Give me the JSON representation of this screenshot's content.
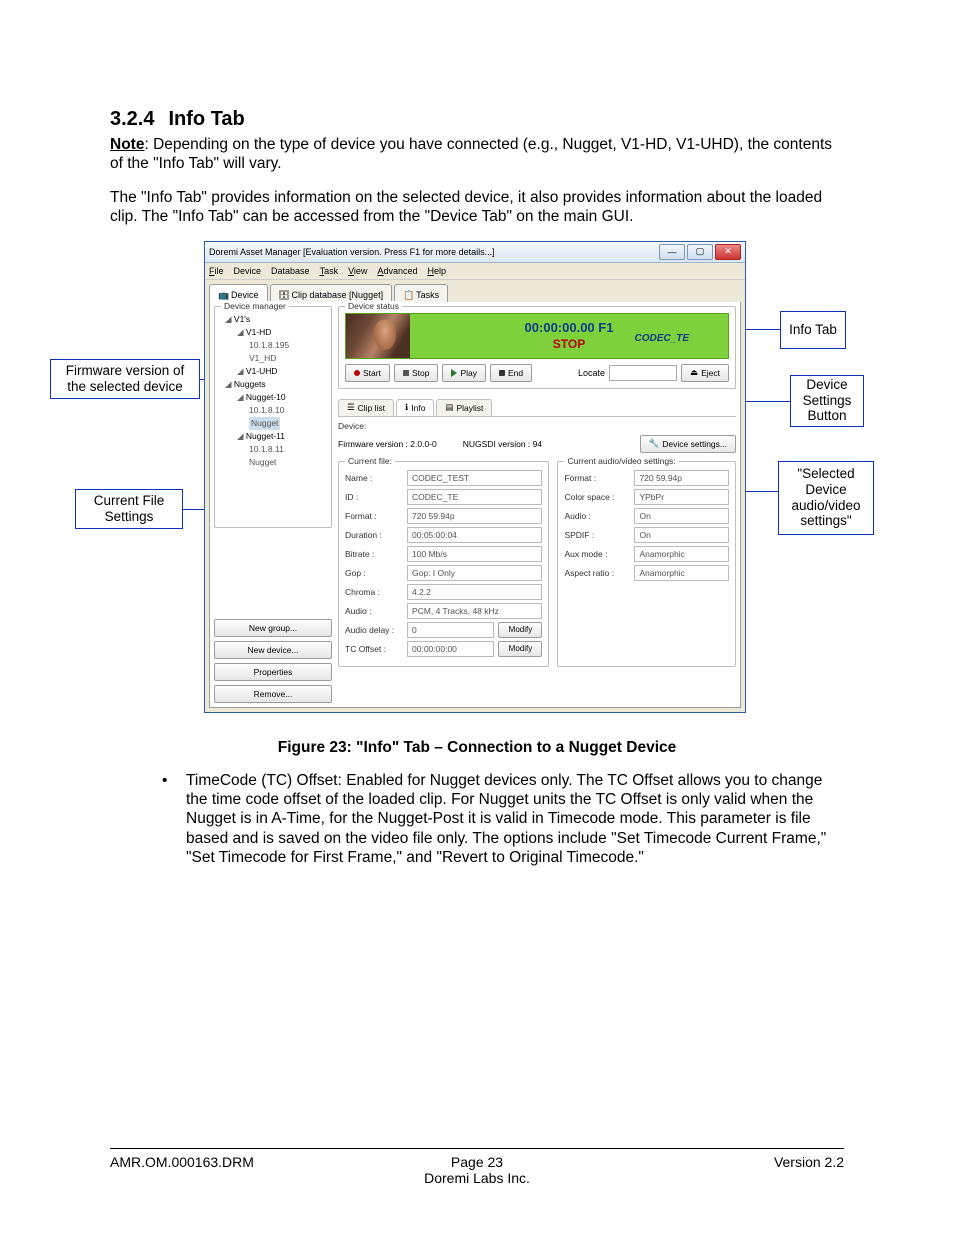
{
  "heading": {
    "num": "3.2.4",
    "title": "Info Tab"
  },
  "note_label": "Note",
  "note_text": ": Depending on the type of device you have connected (e.g., Nugget, V1-HD, V1-UHD), the contents of the \"Info Tab\" will vary.",
  "para2": "The \"Info Tab\" provides information on the selected device, it also provides information about the loaded clip. The \"Info Tab\" can be accessed from the \"Device Tab\" on the main GUI.",
  "figure_caption": "Figure 23: \"Info\" Tab – Connection to a Nugget Device",
  "bullet": {
    "marker": "•",
    "text": "TimeCode (TC) Offset: Enabled for Nugget devices only. The TC Offset allows you to change the time code offset of the loaded clip. For Nugget units the TC Offset is only valid when the Nugget is in A-Time, for the Nugget-Post it is valid in Timecode mode. This parameter is file based and is saved on the video file only.  The options include \"Set Timecode Current Frame,\" \"Set Timecode for First Frame,\" and \"Revert to Original Timecode.\""
  },
  "callouts": {
    "firmware": "Firmware version of the selected device",
    "current_file": "Current File Settings",
    "info_tab": "Info Tab",
    "device_settings": "Device Settings Button",
    "selected_av": "\"Selected Device audio/video settings\""
  },
  "window": {
    "title": "Doremi Asset Manager [Evaluation version. Press F1 for more details...]",
    "menu": [
      "File",
      "Device",
      "Database",
      "Task",
      "View",
      "Advanced",
      "Help"
    ],
    "tabs": [
      "Device",
      "Clip database [Nugget]",
      "Tasks"
    ],
    "sidebar": {
      "title": "Device manager",
      "tree": [
        {
          "l": 1,
          "t": "V1's"
        },
        {
          "l": 2,
          "t": "V1-HD"
        },
        {
          "l": 3,
          "t": "10.1.8.195"
        },
        {
          "l": 3,
          "t": "V1_HD"
        },
        {
          "l": 2,
          "t": "V1-UHD"
        },
        {
          "l": 1,
          "t": "Nuggets"
        },
        {
          "l": 2,
          "t": "Nugget-10"
        },
        {
          "l": 3,
          "t": "10.1.8.10"
        },
        {
          "l": 3,
          "t": "Nugget",
          "sel": true
        },
        {
          "l": 2,
          "t": "Nugget-11"
        },
        {
          "l": 3,
          "t": "10.1.8.11"
        },
        {
          "l": 3,
          "t": "Nugget"
        }
      ],
      "buttons": [
        "New group...",
        "New device...",
        "Properties",
        "Remove..."
      ]
    },
    "status": {
      "group": "Device status",
      "timecode": "00:00:00.00 F1",
      "state": "STOP",
      "codec": "CODEC_TE",
      "transport": {
        "start": "Start",
        "stop": "Stop",
        "play": "Play",
        "end": "End",
        "locate": "Locate",
        "eject": "Eject"
      }
    },
    "subtabs": [
      "Clip list",
      "Info",
      "Playlist"
    ],
    "device_line": {
      "label": "Device:",
      "fw_label": "Firmware version :",
      "fw": "2.0.0-0",
      "nugsdi_label": "NUGSDI version :",
      "nugsdi": "94",
      "settings_btn": "Device settings..."
    },
    "current_file": {
      "title": "Current file:",
      "rows": [
        {
          "k": "Name :",
          "v": "CODEC_TEST"
        },
        {
          "k": "ID :",
          "v": "CODEC_TE"
        },
        {
          "k": "Format :",
          "v": "720 59.94p"
        },
        {
          "k": "Duration :",
          "v": "00:05:00:04"
        },
        {
          "k": "Bitrate :",
          "v": "100 Mb/s"
        },
        {
          "k": "Gop :",
          "v": "Gop: I Only"
        },
        {
          "k": "Chroma :",
          "v": "4.2.2"
        },
        {
          "k": "Audio :",
          "v": "PCM, 4 Tracks, 48 kHz"
        },
        {
          "k": "Audio delay :",
          "v": "0",
          "btn": "Modify"
        },
        {
          "k": "TC Offset :",
          "v": "00:00:00:00",
          "btn": "Modify"
        }
      ]
    },
    "av_settings": {
      "title": "Current audio/video settings:",
      "rows": [
        {
          "k": "Format :",
          "v": "720 59.94p"
        },
        {
          "k": "Color space :",
          "v": "YPbPr"
        },
        {
          "k": "Audio :",
          "v": "On"
        },
        {
          "k": "SPDIF :",
          "v": "On"
        },
        {
          "k": "Aux mode :",
          "v": "Anamorphic"
        },
        {
          "k": "Aspect ratio :",
          "v": "Anamorphic"
        }
      ]
    }
  },
  "footer": {
    "left": "AMR.OM.000163.DRM",
    "center1": "Page 23",
    "center2": "Doremi Labs Inc.",
    "right": "Version 2.2"
  }
}
